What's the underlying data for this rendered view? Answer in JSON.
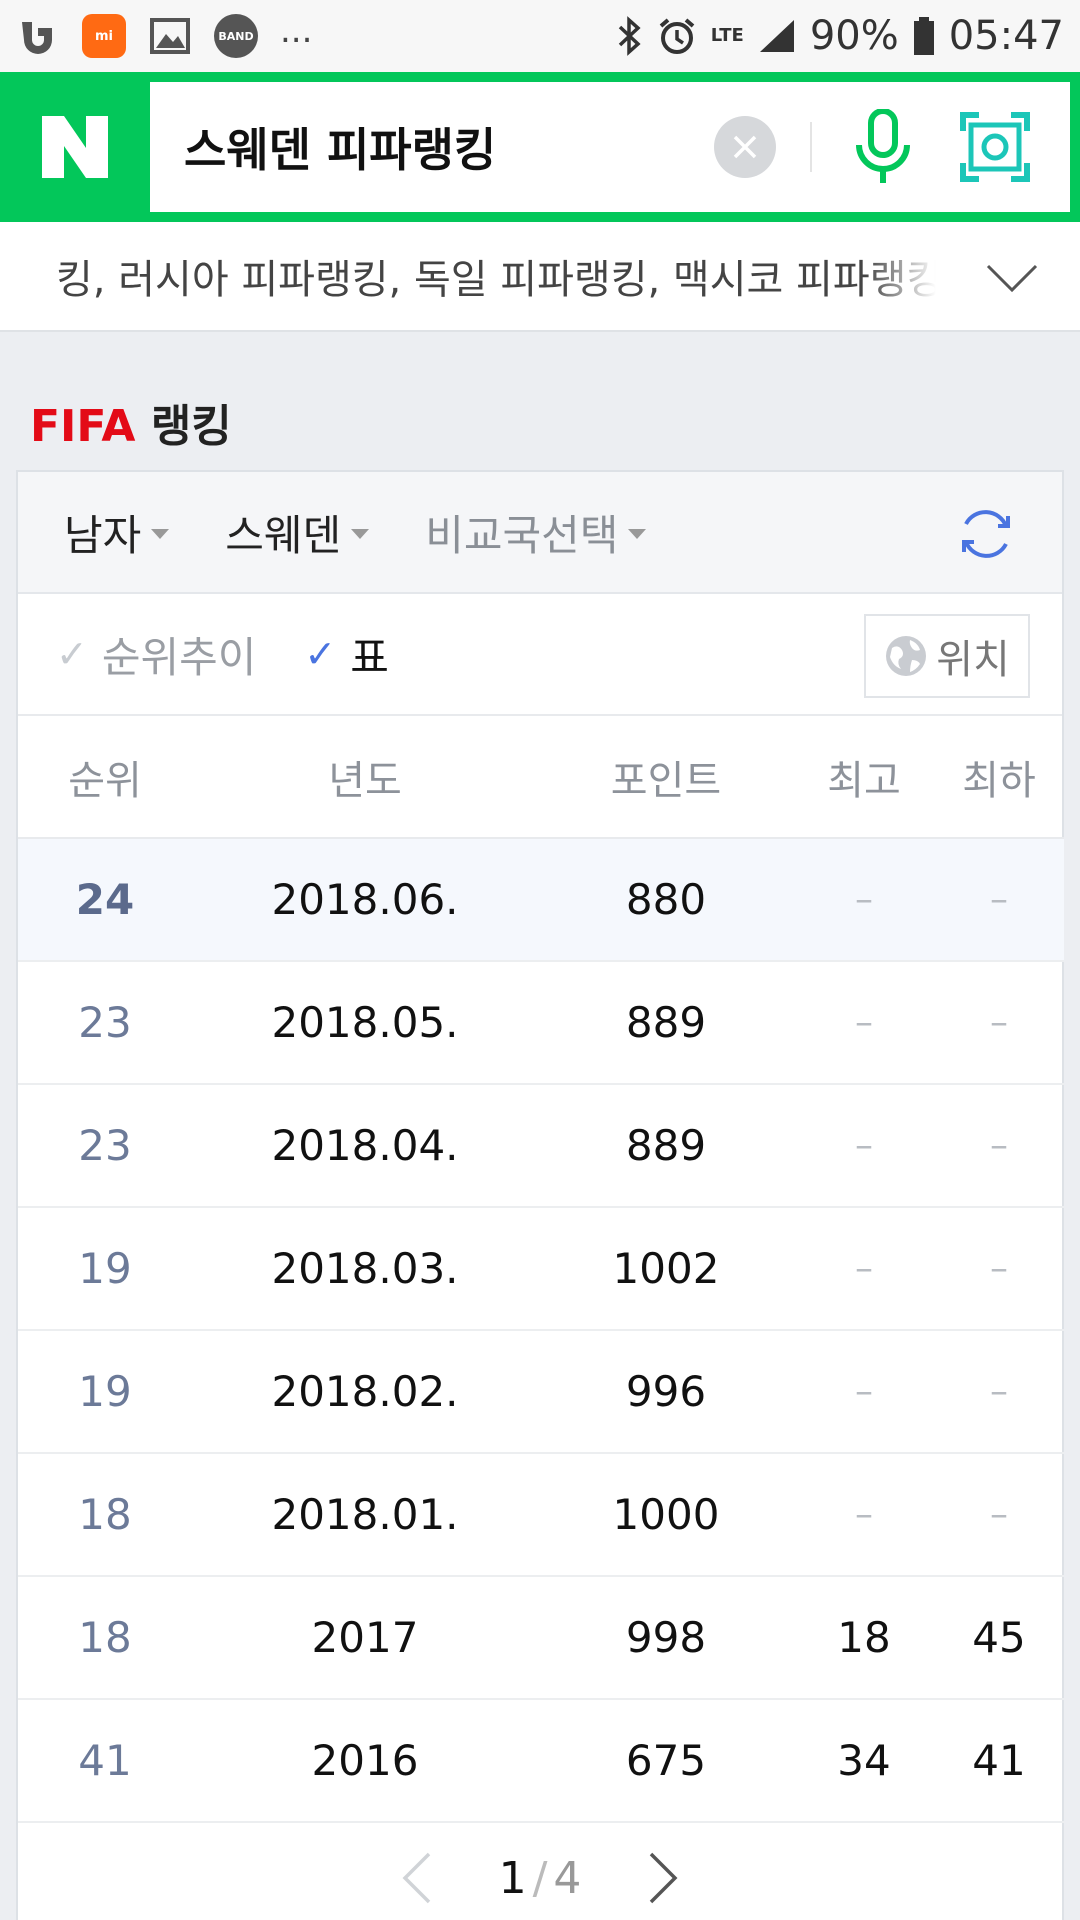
{
  "status_bar": {
    "app_icons": [
      "uplus-icon",
      "mi-icon",
      "gallery-icon",
      "band-icon"
    ],
    "band_label": "BAND",
    "mi_label": "mi",
    "more": "...",
    "network": "LTE",
    "battery": "90%",
    "time": "05:47"
  },
  "search": {
    "logo": "N",
    "query": "스웨덴 피파랭킹",
    "brand_color": "#03c75a"
  },
  "related": {
    "text": "킹, 러시아 피파랭킹, 독일 피파랭킹, 맥시코 피파랭킹"
  },
  "section": {
    "brand": "FIFA",
    "title": "랭킹"
  },
  "filters": {
    "gender": "남자",
    "country": "스웨덴",
    "compare": "비교국선택"
  },
  "view": {
    "trend": "순위추이",
    "table": "표",
    "location": "위치"
  },
  "table": {
    "headers": [
      "순위",
      "년도",
      "포인트",
      "최고",
      "최하"
    ],
    "rows": [
      {
        "rank": "24",
        "year": "2018.06.",
        "points": "880",
        "best": "–",
        "worst": "–"
      },
      {
        "rank": "23",
        "year": "2018.05.",
        "points": "889",
        "best": "–",
        "worst": "–"
      },
      {
        "rank": "23",
        "year": "2018.04.",
        "points": "889",
        "best": "–",
        "worst": "–"
      },
      {
        "rank": "19",
        "year": "2018.03.",
        "points": "1002",
        "best": "–",
        "worst": "–"
      },
      {
        "rank": "19",
        "year": "2018.02.",
        "points": "996",
        "best": "–",
        "worst": "–"
      },
      {
        "rank": "18",
        "year": "2018.01.",
        "points": "1000",
        "best": "–",
        "worst": "–"
      },
      {
        "rank": "18",
        "year": "2017",
        "points": "998",
        "best": "18",
        "worst": "45"
      },
      {
        "rank": "41",
        "year": "2016",
        "points": "675",
        "best": "34",
        "worst": "41"
      }
    ]
  },
  "pagination": {
    "current": "1",
    "separator": "/",
    "total": "4"
  }
}
